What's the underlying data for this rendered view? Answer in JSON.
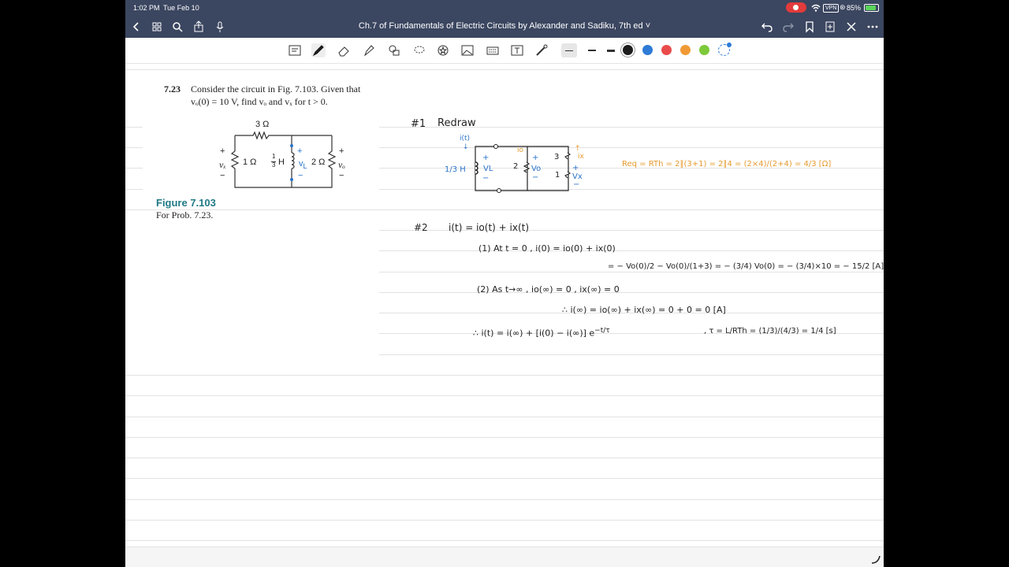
{
  "status_bar": {
    "time": "1:02 PM",
    "date": "Tue Feb 10",
    "vpn": "VPN",
    "battery": "85%"
  },
  "nav": {
    "title": "Ch.7 of Fundamentals of Electric Circuits by Alexander and Sadiku, 7th ed"
  },
  "colors": {
    "nav_bg": "#3b4660",
    "teal": "#1f7a86",
    "blue_ink": "#2a74c9",
    "orange_ink": "#e69a2e",
    "swatches": [
      "#1c1c1c",
      "#2d7bd6",
      "#e94b4b",
      "#f09a35",
      "#7dc93a"
    ]
  },
  "problem": {
    "number": "7.23",
    "line1": "Consider the circuit in Fig. 7.103. Given that",
    "line2": "vₒ(0) = 10 V, find vₒ and vₓ for t > 0.",
    "figure_label": "Figure 7.103",
    "figure_caption": "For Prob. 7.23.",
    "circuit": {
      "r_top": "3 Ω",
      "r_left": "1 Ω",
      "inductor": "H",
      "r_right": "2 Ω",
      "frac_num": "1",
      "frac_den": "3",
      "vx": "vₓ",
      "vo": "vₒ",
      "vl": "v",
      "vl_sub": "L",
      "plus": "+",
      "minus": "−"
    }
  },
  "notes": {
    "step1_num": "#1",
    "step1_title": "Redraw",
    "redraw": {
      "it": "i(t)",
      "L": "1/3 H",
      "vl": "VL",
      "two": "2",
      "vo": "Vo",
      "io": "io",
      "three": "3",
      "one": "1",
      "ix": "ix",
      "vx": "Vx",
      "plus": "+",
      "minus": "−"
    },
    "req": "Req = RTh = 2∥(3+1) = 2∥4 = (2×4)/(2+4) = 4/3 [Ω]",
    "step2_num": "#2",
    "step2_eq": "i(t)  =  io(t) + ix(t)",
    "l1": "(1)   At  t = 0 ,   i(0)  =  io(0) + ix(0)",
    "l2": "=  − Vo(0)/2  −  Vo(0)/(1+3)  =  − (3/4) Vo(0) = − (3/4)×10 = − 15/2 [A]",
    "l3": "(2)   As  t→∞ ,   io(∞) = 0 ,   ix(∞) = 0",
    "l4": "∴  i(∞)  =  io(∞) + ix(∞) = 0 + 0 = 0  [A]",
    "l5": "∴  i(t) = i(∞) + [i(0) − i(∞)] e",
    "l5_exp": "−t/τ",
    "l6": ",   τ = L/RTh = (1/3)/(4/3) = 1/4 [s]"
  }
}
